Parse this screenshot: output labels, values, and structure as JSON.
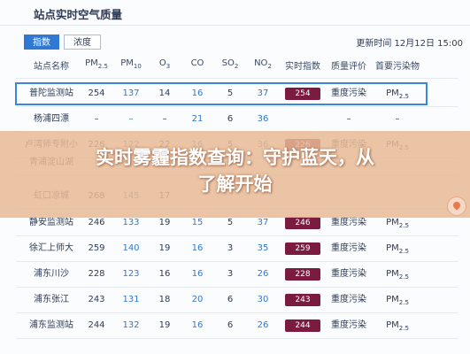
{
  "app": {
    "title": "站点实时空气质量",
    "updated": "更新时间 12月12日 15:00"
  },
  "tabs": [
    {
      "label": "指数",
      "active": true
    },
    {
      "label": "浓度",
      "active": false
    }
  ],
  "columns": [
    "站点名称",
    "PM",
    "PM",
    "O",
    "CO",
    "SO",
    "NO",
    "实时指数",
    "质量评价",
    "首要污染物"
  ],
  "column_subscripts": [
    "",
    "2.5",
    "10",
    "3",
    "",
    "2",
    "2",
    "",
    "",
    ""
  ],
  "rows": [
    {
      "name": "普陀监测站",
      "pm25": "254",
      "pm10": "137",
      "o3": "14",
      "co": "16",
      "so2": "5",
      "no2": "37",
      "aqi": "254",
      "quality": "重度污染",
      "pollutant": "PM",
      "pollutant_sub": "2.5"
    },
    {
      "name": "杨浦四漂",
      "pm25": "–",
      "pm10": "–",
      "o3": "–",
      "co": "21",
      "so2": "6",
      "no2": "36",
      "aqi": "",
      "quality": "–",
      "pollutant": "–",
      "pollutant_sub": ""
    },
    {
      "name": "卢湾师专附小",
      "pm25": "226",
      "pm10": "122",
      "o3": "22",
      "co": "16",
      "so2": "5",
      "no2": "36",
      "aqi": "226",
      "quality": "重度污染",
      "pollutant": "PM",
      "pollutant_sub": "2.5"
    },
    {
      "name": "青浦淀山湖",
      "pm25": "",
      "pm10": "",
      "o3": "",
      "co": "",
      "so2": "",
      "no2": "",
      "aqi": "",
      "quality": "",
      "pollutant": "",
      "pollutant_sub": ""
    },
    {
      "name": "虹口凉城",
      "pm25": "268",
      "pm10": "145",
      "o3": "17",
      "co": "",
      "so2": "",
      "no2": "",
      "aqi": "",
      "quality": "",
      "pollutant": "",
      "pollutant_sub": ""
    },
    {
      "name": "静安监测站",
      "pm25": "246",
      "pm10": "133",
      "o3": "19",
      "co": "15",
      "so2": "5",
      "no2": "37",
      "aqi": "246",
      "quality": "重度污染",
      "pollutant": "PM",
      "pollutant_sub": "2.5"
    },
    {
      "name": "徐汇上师大",
      "pm25": "259",
      "pm10": "140",
      "o3": "19",
      "co": "16",
      "so2": "3",
      "no2": "35",
      "aqi": "259",
      "quality": "重度污染",
      "pollutant": "PM",
      "pollutant_sub": "2.5"
    },
    {
      "name": "浦东川沙",
      "pm25": "228",
      "pm10": "123",
      "o3": "16",
      "co": "16",
      "so2": "3",
      "no2": "26",
      "aqi": "228",
      "quality": "重度污染",
      "pollutant": "PM",
      "pollutant_sub": "2.5"
    },
    {
      "name": "浦东张江",
      "pm25": "243",
      "pm10": "131",
      "o3": "18",
      "co": "20",
      "so2": "6",
      "no2": "30",
      "aqi": "243",
      "quality": "重度污染",
      "pollutant": "PM",
      "pollutant_sub": "2.5"
    },
    {
      "name": "浦东监测站",
      "pm25": "244",
      "pm10": "132",
      "o3": "19",
      "co": "16",
      "so2": "6",
      "no2": "26",
      "aqi": "244",
      "quality": "重度污染",
      "pollutant": "PM",
      "pollutant_sub": "2.5"
    }
  ],
  "banner": {
    "line1": "实时雾霾指数查询：守护蓝天，从",
    "line2": "了解开始"
  },
  "colors": {
    "accent": "#2f78d4",
    "badge": "#7a1b3f",
    "banner": "#e8ba96"
  }
}
